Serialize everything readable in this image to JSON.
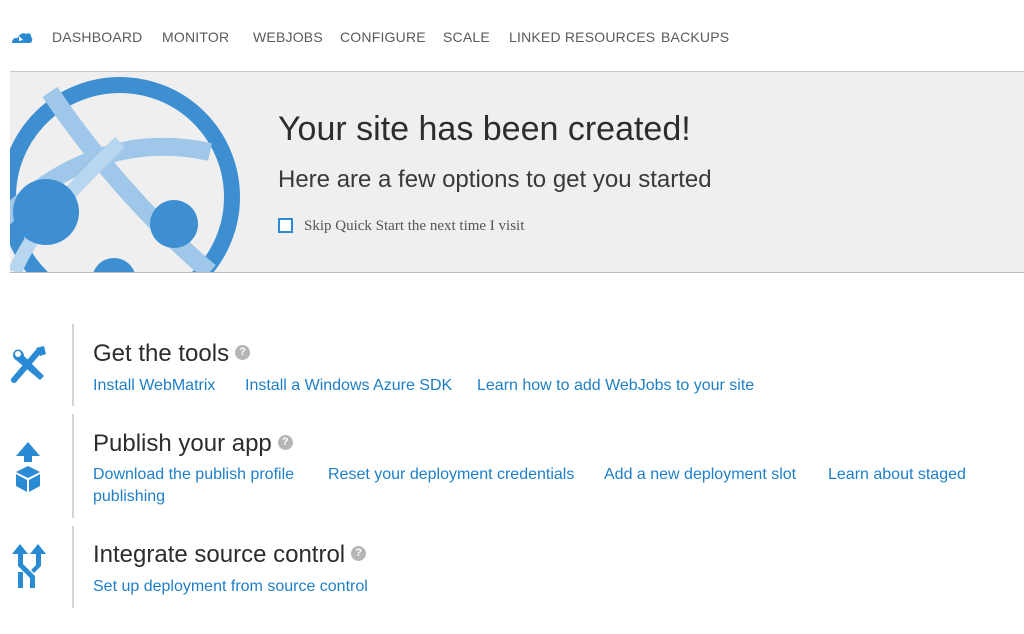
{
  "nav": {
    "logo_icon": "cloud-icon",
    "items": [
      "DASHBOARD",
      "MONITOR",
      "WEBJOBS",
      "CONFIGURE",
      "SCALE",
      "LINKED RESOURCES",
      "BACKUPS"
    ]
  },
  "hero": {
    "icon": "website-globe-icon",
    "title": "Your site has been created!",
    "subtitle": "Here are a few options to get you started",
    "skip_label": "Skip Quick Start the next time I visit",
    "skip_checked": false
  },
  "sections": [
    {
      "icon": "tools-icon",
      "title": "Get the tools",
      "links": [
        "Install WebMatrix",
        "Install a Windows Azure SDK",
        "Learn how to add WebJobs to your site"
      ]
    },
    {
      "icon": "publish-icon",
      "title": "Publish your app",
      "links": [
        "Download the publish profile",
        "Reset your deployment credentials",
        "Add a new deployment slot",
        "Learn about staged",
        "publishing"
      ]
    },
    {
      "icon": "source-control-icon",
      "title": "Integrate source control",
      "links": [
        "Set up deployment from source control"
      ]
    }
  ],
  "colors": {
    "accent": "#2a8ad4",
    "link": "#1e7fc8",
    "hero_bg": "#efefef"
  }
}
